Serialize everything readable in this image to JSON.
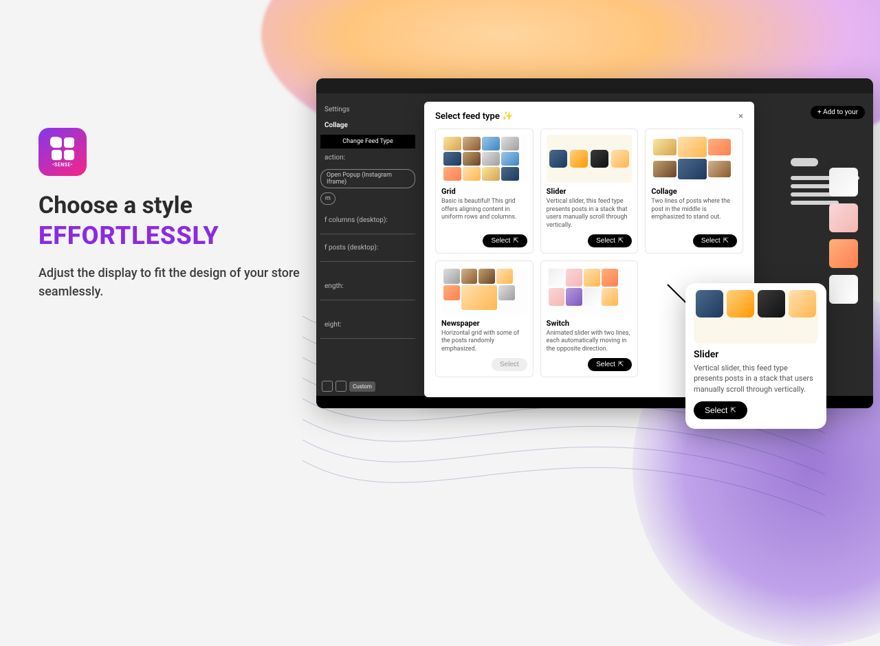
{
  "left": {
    "sublabel": "•SENSE•",
    "title_line1": "Choose a style",
    "title_line2": "EFFORTLESSLY",
    "subtitle": "Adjust the display to fit the design of your store seamlessly."
  },
  "appwin": {
    "settings": "Settings",
    "collage": "Collage",
    "change": "Change Feed Type",
    "action_label": "action:",
    "action_value": "Open Popup (Instagram Iframe)",
    "m": "m",
    "cols": "f columns (desktop):",
    "posts": "f posts (desktop):",
    "length": "ength:",
    "height": "eight:",
    "custom": "Custom",
    "add_btn": "+  Add to your"
  },
  "modal": {
    "title": "Select feed type ✨",
    "close": "×",
    "select": "Select",
    "cards": [
      {
        "name": "Grid",
        "desc": "Basic is beautiful! This grid offers aligning content in uniform rows and columns."
      },
      {
        "name": "Slider",
        "desc": "Vertical slider, this feed type presents posts in a stack that users manually scroll through vertically."
      },
      {
        "name": "Collage",
        "desc": "Two lines of posts where the post in the middle is emphasized to stand out."
      },
      {
        "name": "Newspaper",
        "desc": "Horizontal grid with some of the posts randomly emphasized."
      },
      {
        "name": "Switch",
        "desc": "Animated slider with two lines, each automatically moving in the opposite direction."
      }
    ]
  },
  "bigcard": {
    "name": "Slider",
    "desc": "Vertical slider, this feed type presents posts in a stack that users manually scroll through vertically.",
    "select": "Select"
  }
}
